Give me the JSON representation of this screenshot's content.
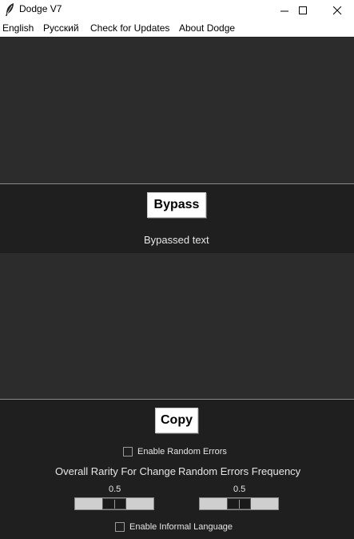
{
  "window": {
    "title": "Dodge V7"
  },
  "menu": {
    "items": [
      "English",
      "Русский",
      "Check for Updates",
      "About Dodge"
    ]
  },
  "input_text": {
    "value": ""
  },
  "bypass_button": {
    "label": "Bypass"
  },
  "output_label": "Bypassed text",
  "output_text": {
    "value": ""
  },
  "copy_button": {
    "label": "Copy"
  },
  "random_errors": {
    "label": "Enable Random Errors",
    "checked": false
  },
  "rarity": {
    "label": "Overall Rarity For Change",
    "value": "0.5",
    "level": 0.5
  },
  "frequency": {
    "label": "Random Errors Frequency",
    "value": "0.5",
    "level": 0.5
  },
  "informal": {
    "label": "Enable Informal Language",
    "checked": false
  },
  "icons": {
    "app": "feather-icon",
    "minimize": "minimize-icon",
    "maximize": "maximize-icon",
    "close": "close-icon"
  }
}
